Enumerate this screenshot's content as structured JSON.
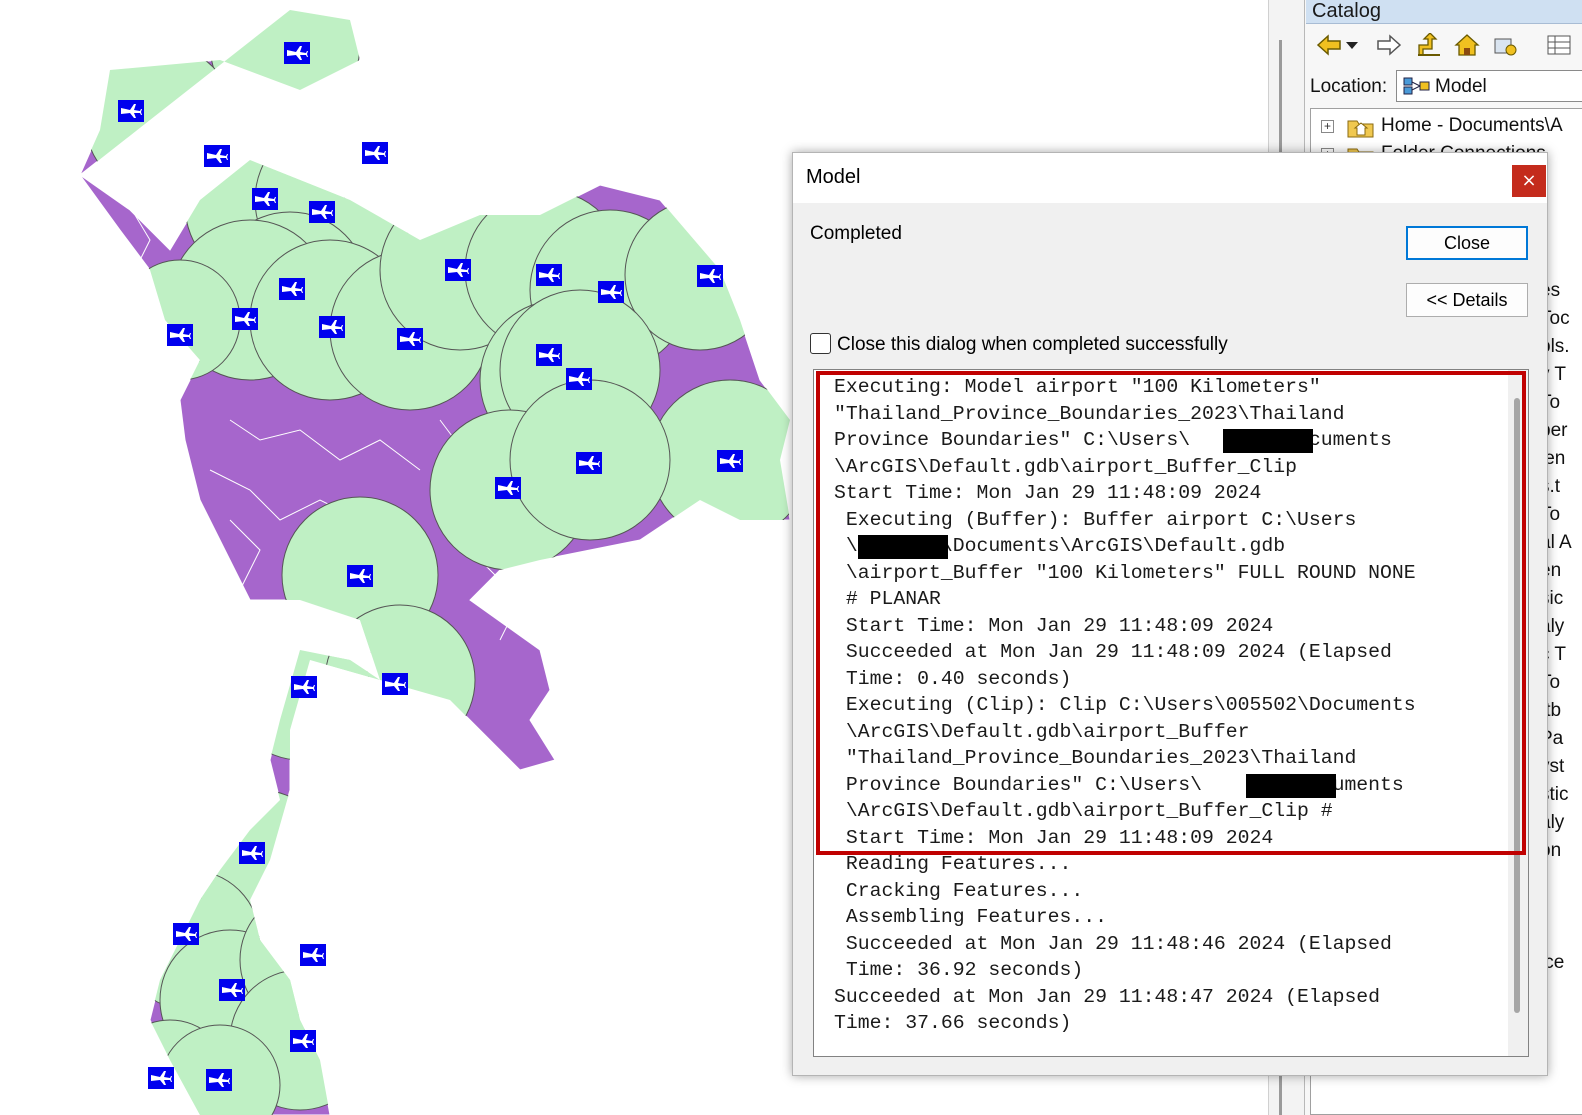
{
  "colors": {
    "land": "#a666cc",
    "buffer_fill": "#bff0c4",
    "buffer_stroke": "#555555",
    "airport_marker": "#0000ee",
    "dialog_close_red": "#c42b1c",
    "highlight_red": "#c00000"
  },
  "map": {
    "airport_icon": "airplane-icon"
  },
  "catalog": {
    "title": "Catalog",
    "location_label": "Location:",
    "location_value": "Model",
    "tree_items": [
      "Home - Documents\\A",
      "Folder Connections"
    ],
    "toolbar_icons": [
      "back-arrow-icon",
      "dropdown-arrow-icon",
      "forward-arrow-icon",
      "up-folder-icon",
      "home-icon",
      "connect-folder-icon",
      "view-options-icon"
    ],
    "right_fragments": [
      "es",
      "Toc",
      "ols.",
      "y T",
      "To",
      "per",
      "jen",
      "s.t",
      "To",
      "al A",
      "en",
      "sic",
      "aly",
      "c T",
      "To",
      ".tb",
      "Pa",
      "yst",
      "stic",
      "aly",
      "on",
      "",
      "",
      "",
      "ice"
    ]
  },
  "dialog": {
    "title": "Model",
    "close_x": "×",
    "status": "Completed",
    "close_button": "Close",
    "details_button": "<< Details",
    "checkbox_label": "Close this dialog when completed successfully",
    "checkbox_checked": false,
    "log_lines": [
      "Executing: Model airport \"100 Kilometers\"",
      "\"Thailand_Province_Boundaries_2023\\Thailand",
      "Province Boundaries\" C:\\Users\\       \\Documents",
      "\\ArcGIS\\Default.gdb\\airport_Buffer_Clip",
      "Start Time: Mon Jan 29 11:48:09 2024",
      " Executing (Buffer): Buffer airport C:\\Users",
      " \\       \\Documents\\ArcGIS\\Default.gdb",
      " \\airport_Buffer \"100 Kilometers\" FULL ROUND NONE",
      " # PLANAR",
      " Start Time: Mon Jan 29 11:48:09 2024",
      " Succeeded at Mon Jan 29 11:48:09 2024 (Elapsed",
      " Time: 0.40 seconds)",
      " Executing (Clip): Clip C:\\Users\\005502\\Documents",
      " \\ArcGIS\\Default.gdb\\airport_Buffer",
      " \"Thailand_Province_Boundaries_2023\\Thailand",
      " Province Boundaries\" C:\\Users\\       \\Documents",
      " \\ArcGIS\\Default.gdb\\airport_Buffer_Clip #",
      " Start Time: Mon Jan 29 11:48:09 2024",
      " Reading Features...",
      " Cracking Features...",
      " Assembling Features...",
      " Succeeded at Mon Jan 29 11:48:46 2024 (Elapsed",
      " Time: 36.92 seconds)",
      "Succeeded at Mon Jan 29 11:48:47 2024 (Elapsed",
      "Time: 37.66 seconds)"
    ]
  }
}
